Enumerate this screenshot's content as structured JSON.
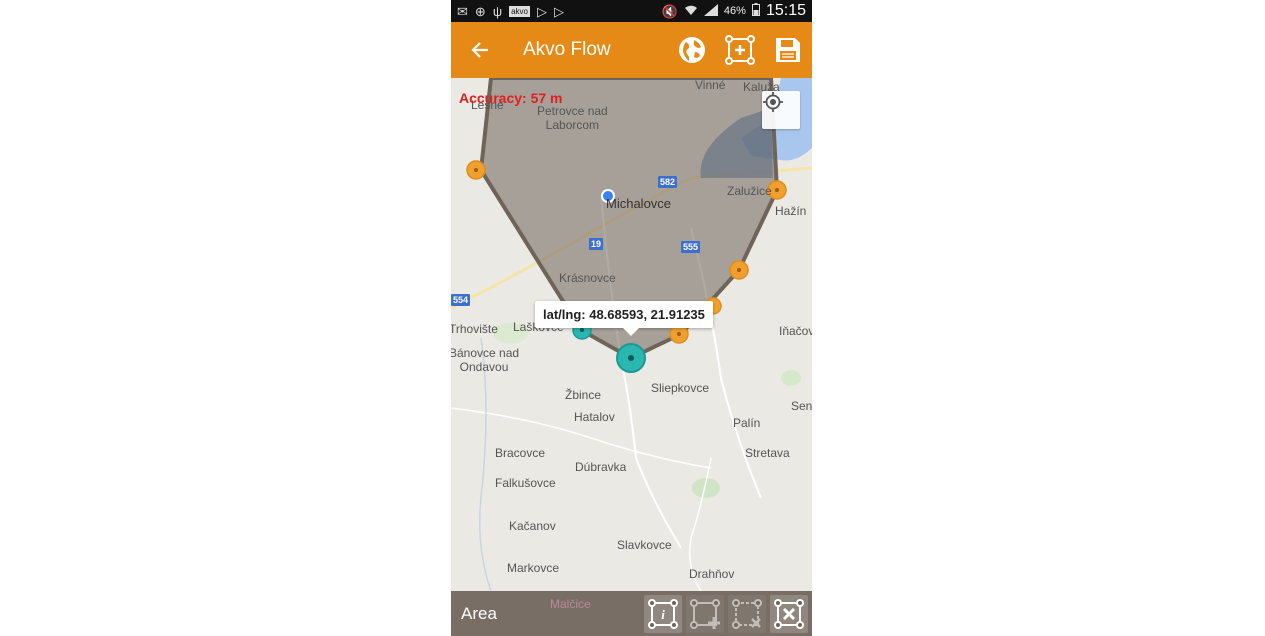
{
  "status_bar": {
    "icons": [
      "mail-icon",
      "gps-icon",
      "usb-icon",
      "akvo-icon",
      "play-store-icon",
      "play-store-icon",
      "mute-icon",
      "wifi-icon",
      "signal-icon"
    ],
    "akvo_badge": "akvo",
    "battery": "46%",
    "time": "15:15"
  },
  "app_bar": {
    "title": "Akvo Flow",
    "background": "#e58a17"
  },
  "map": {
    "accuracy": "Accuracy: 57 m",
    "tooltip": "lat/lng: 48.68593, 21.91235",
    "polygon_color": "#6e645a",
    "vertex_color": "#f0a030",
    "selected_vertex_color": "#2ab7b0",
    "places": {
      "lesne": "Lesné",
      "vinne": "Vinné",
      "kaluza": "Kaluža",
      "petrovce": "Petrovce nad\nLaborcom",
      "michalovce": "Michalovce",
      "zaluzice": "Zalužice",
      "hazin": "Hažín",
      "krasnovce": "Krásnovce",
      "trhoviste": "Trhovište",
      "laskovce": "Laškovce",
      "inacov": "Iňačov",
      "banovce": "Bánovce nad\nOndavou",
      "sliepkovce": "Sliepkovce",
      "zbince": "Žbince",
      "hatalov": "Hatalov",
      "sen": "Sen",
      "palin": "Palín",
      "bracovce": "Bracovce",
      "stretava": "Stretava",
      "dubravka": "Dúbravka",
      "falkusovce": "Falkušovce",
      "kacanov": "Kačanov",
      "slavkovce": "Slavkovce",
      "markovce": "Markovce",
      "drahnov": "Drahňov",
      "malcice": "Malčice"
    },
    "roads": {
      "r582": "582",
      "r555": "555",
      "r19": "19",
      "r554": "554"
    }
  },
  "bottom_bar": {
    "label": "Area"
  }
}
